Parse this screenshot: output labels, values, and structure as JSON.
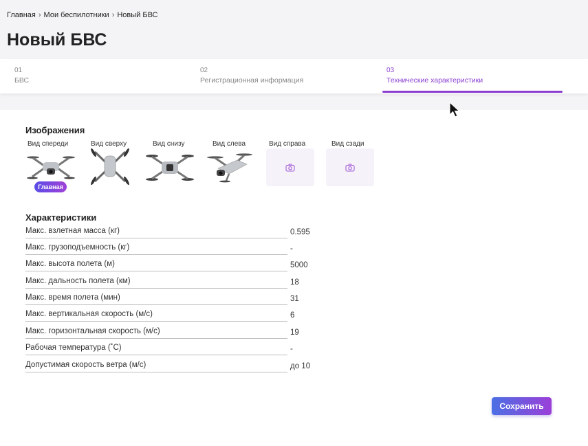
{
  "breadcrumb": [
    "Главная",
    "Мои беспилотники",
    "Новый БВС"
  ],
  "breadcrumb_separator": "›",
  "page_title": "Новый БВС",
  "steps": [
    {
      "num": "01",
      "label": "БВС"
    },
    {
      "num": "02",
      "label": "Регистрационная информация"
    },
    {
      "num": "03",
      "label": "Технические характеристики",
      "active": true
    }
  ],
  "images": {
    "title": "Изображения",
    "views": [
      {
        "label": "Вид спереди",
        "has_image": true,
        "main": true
      },
      {
        "label": "Вид сверху",
        "has_image": true
      },
      {
        "label": "Вид снизу",
        "has_image": true
      },
      {
        "label": "Вид слева",
        "has_image": true
      },
      {
        "label": "Вид справа",
        "has_image": false,
        "icon": "camera-icon"
      },
      {
        "label": "Вид сзади",
        "has_image": false,
        "icon": "camera-icon"
      }
    ],
    "main_badge": "Главная"
  },
  "specs": {
    "title": "Характеристики",
    "rows": [
      {
        "name": "Макс. взлетная масса (кг)",
        "value": "0.595"
      },
      {
        "name": "Макс. грузоподъемность (кг)",
        "value": "-"
      },
      {
        "name": "Макс. высота полета (м)",
        "value": "5000"
      },
      {
        "name": "Макс. дальность полета (км)",
        "value": "18"
      },
      {
        "name": "Макс. время полета (мин)",
        "value": "31"
      },
      {
        "name": "Макс. вертикальная скорость (м/с)",
        "value": "6"
      },
      {
        "name": "Макс. горизонтальная скорость (м/с)",
        "value": "19"
      },
      {
        "name": "Рабочая температура (˚С)",
        "value": "-"
      },
      {
        "name": "Допустимая скорость ветра (м/с)",
        "value": "до 10"
      }
    ]
  },
  "save_label": "Сохранить",
  "colors": {
    "accent": "#8a3fd1",
    "button_gradient_start": "#4b6fe4",
    "button_gradient_end": "#9b3fd8"
  }
}
